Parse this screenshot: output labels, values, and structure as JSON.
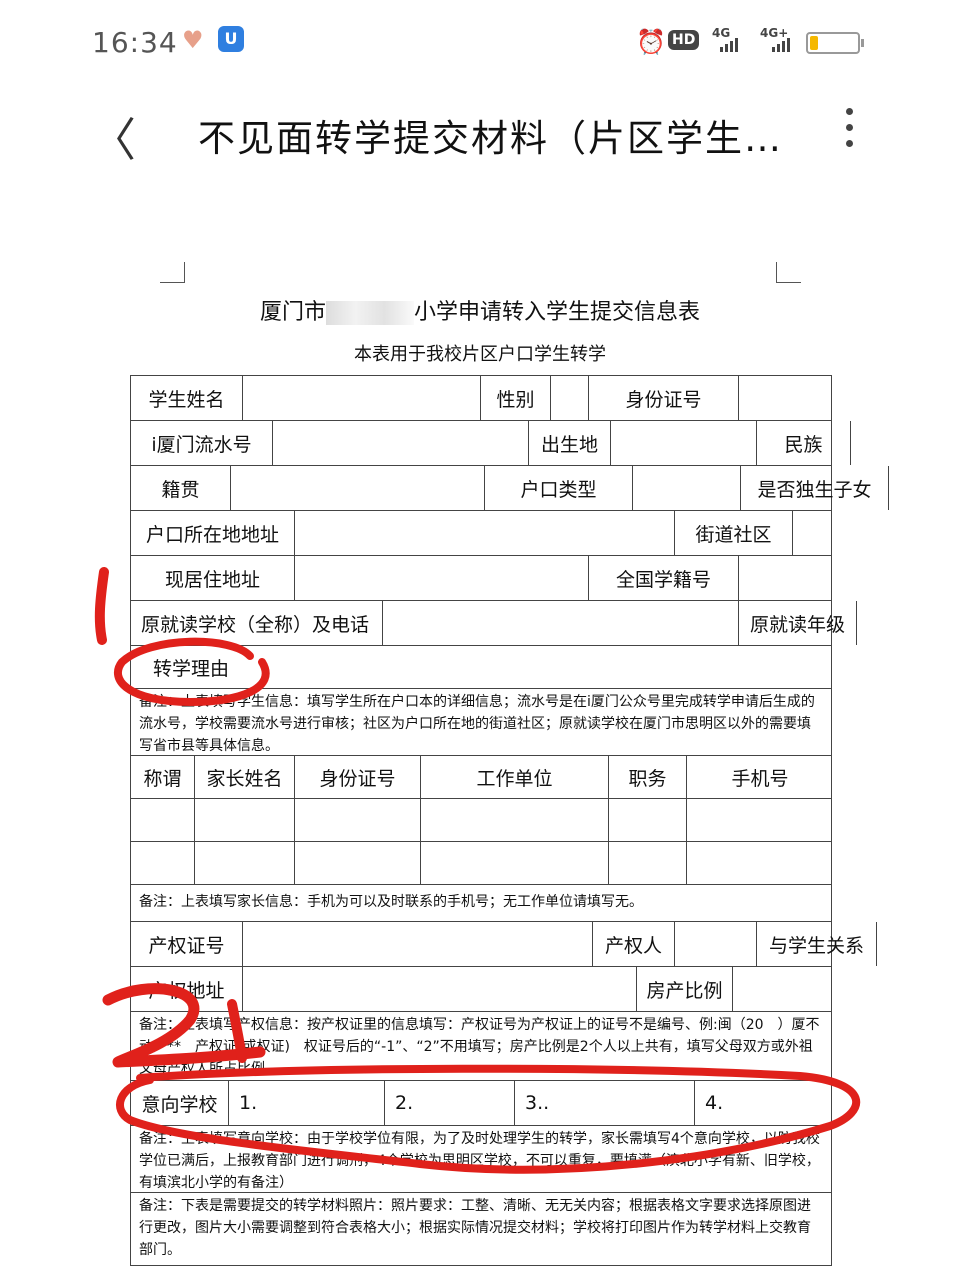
{
  "status_bar": {
    "time": "16:34",
    "heart_icon": "heart-icon",
    "app_icon": "U",
    "alarm_icon": "alarm-icon",
    "hd_label": "HD",
    "signal1_label": "4G",
    "signal2_label": "4G+"
  },
  "header": {
    "back_icon": "chevron-left-icon",
    "title": "不见面转学提交材料（片区学生…",
    "more_icon": "more-vertical-icon"
  },
  "document": {
    "title_prefix": "厦门市",
    "title_suffix": "小学申请转入学生提交信息表",
    "subtitle": "本表用于我校片区户口学生转学",
    "student_rows": [
      [
        "学生姓名",
        "",
        "性别",
        "",
        "身份证号",
        ""
      ],
      [
        "i厦门流水号",
        "",
        "出生地",
        "",
        "民族",
        ""
      ],
      [
        "籍贯",
        "",
        "户口类型",
        "",
        "是否独生子女",
        ""
      ],
      [
        "户口所在地地址",
        "",
        "街道社区",
        ""
      ],
      [
        "现居住地址",
        "",
        "全国学籍号",
        ""
      ],
      [
        "原就读学校（全称）及电话",
        "",
        "原就读年级",
        ""
      ],
      [
        "转学理由"
      ]
    ],
    "note1": "备注：上表填写学生信息：填写学生所在户口本的详细信息；流水号是在i厦门公众号里完成转学申请后生成的流水号，学校需要流水号进行审核；社区为户口所在地的街道社区；原就读学校在厦门市思明区以外的需要填写省市县等具体信息。",
    "parent_headers": [
      "称谓",
      "家长姓名",
      "身份证号",
      "工作单位",
      "职务",
      "手机号"
    ],
    "note2": "备注：上表填写家长信息：手机为可以及时联系的手机号；无工作单位请填写无。",
    "property_rows": [
      [
        "产权证号",
        "",
        "产权人",
        "",
        "与学生关系",
        ""
      ],
      [
        "产权地址",
        "",
        "房产比例",
        ""
      ]
    ],
    "note3": "备注：上表填写产权信息：按产权证里的信息填写：产权证号为产权证上的证号不是编号、例:闽（20　）厦不动产**　产权证(或权证)　权证号后的“-1”、“2”不用填写；房产比例是2个人以上共有，填写父母双方或外祖父母产权人所占比例。",
    "school_row": [
      "意向学校",
      "1.",
      "2.",
      "3..",
      "4."
    ],
    "note4": "备注：上表填写意向学校：由于学校学位有限，为了及时处理学生的转学，家长需填写4个意向学校，以防我校学位已满后，上报教育部门进行调剂，4个学校为思明区学校，不可以重复，要填满（滨北小学有新、旧学校，有填滨北小学的有备注）",
    "note5": "备注：下表是需要提交的转学材料照片：照片要求：工整、清晰、无无关内容；根据表格文字要求选择原图进行更改，图片大小需要调整到符合表格大小；根据实际情况提交材料；学校将打印图片作为转学材料上交教育部门。"
  },
  "annotations": {
    "marker_1": "1",
    "marker_2": "2",
    "ink_color": "#e0211b"
  }
}
